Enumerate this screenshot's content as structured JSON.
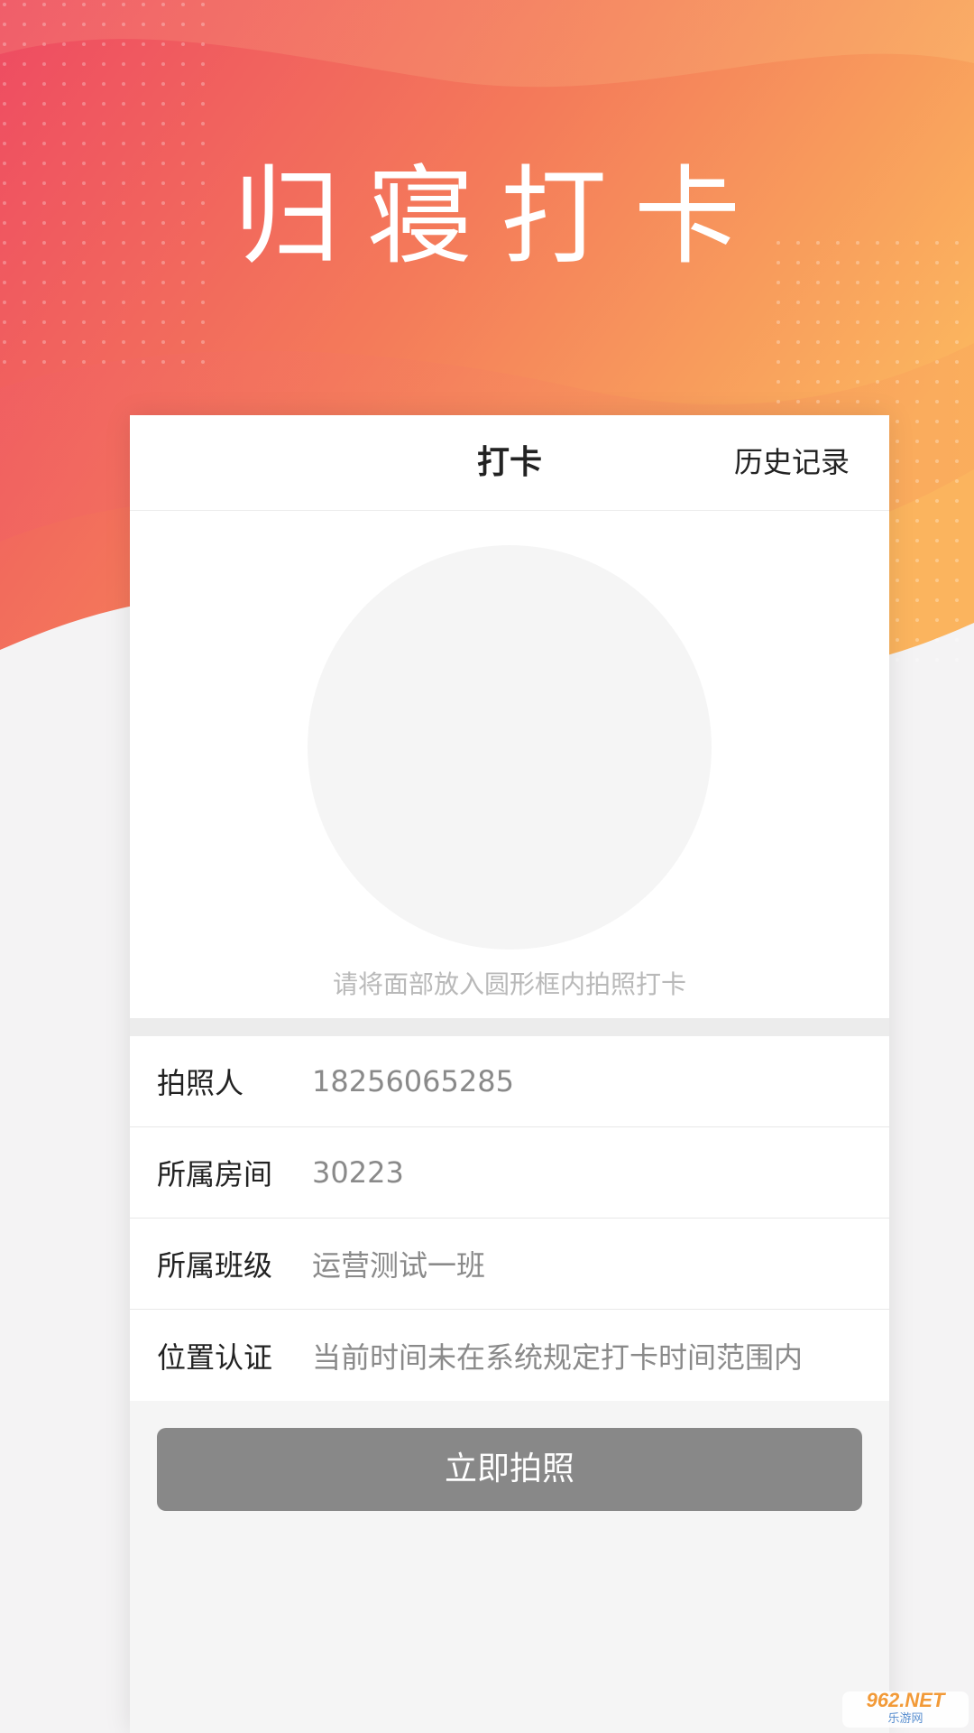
{
  "header": {
    "title": "归寝打卡"
  },
  "card": {
    "tab_title": "打卡",
    "history_label": "历史记录",
    "hint": "请将面部放入圆形框内拍照打卡"
  },
  "info": {
    "rows": [
      {
        "label": "拍照人",
        "value": "18256065285"
      },
      {
        "label": "所属房间",
        "value": "30223"
      },
      {
        "label": "所属班级",
        "value": "运营测试一班"
      },
      {
        "label": "位置认证",
        "value": "当前时间未在系统规定打卡时间范围内"
      }
    ]
  },
  "actions": {
    "take_photo_label": "立即拍照"
  },
  "watermark": {
    "main": "962.NET",
    "sub": "乐游网"
  },
  "colors": {
    "gradient_start": "#ef4a63",
    "gradient_end": "#fbb35e",
    "button_bg": "#888888",
    "value_text": "#8a8a8a"
  }
}
